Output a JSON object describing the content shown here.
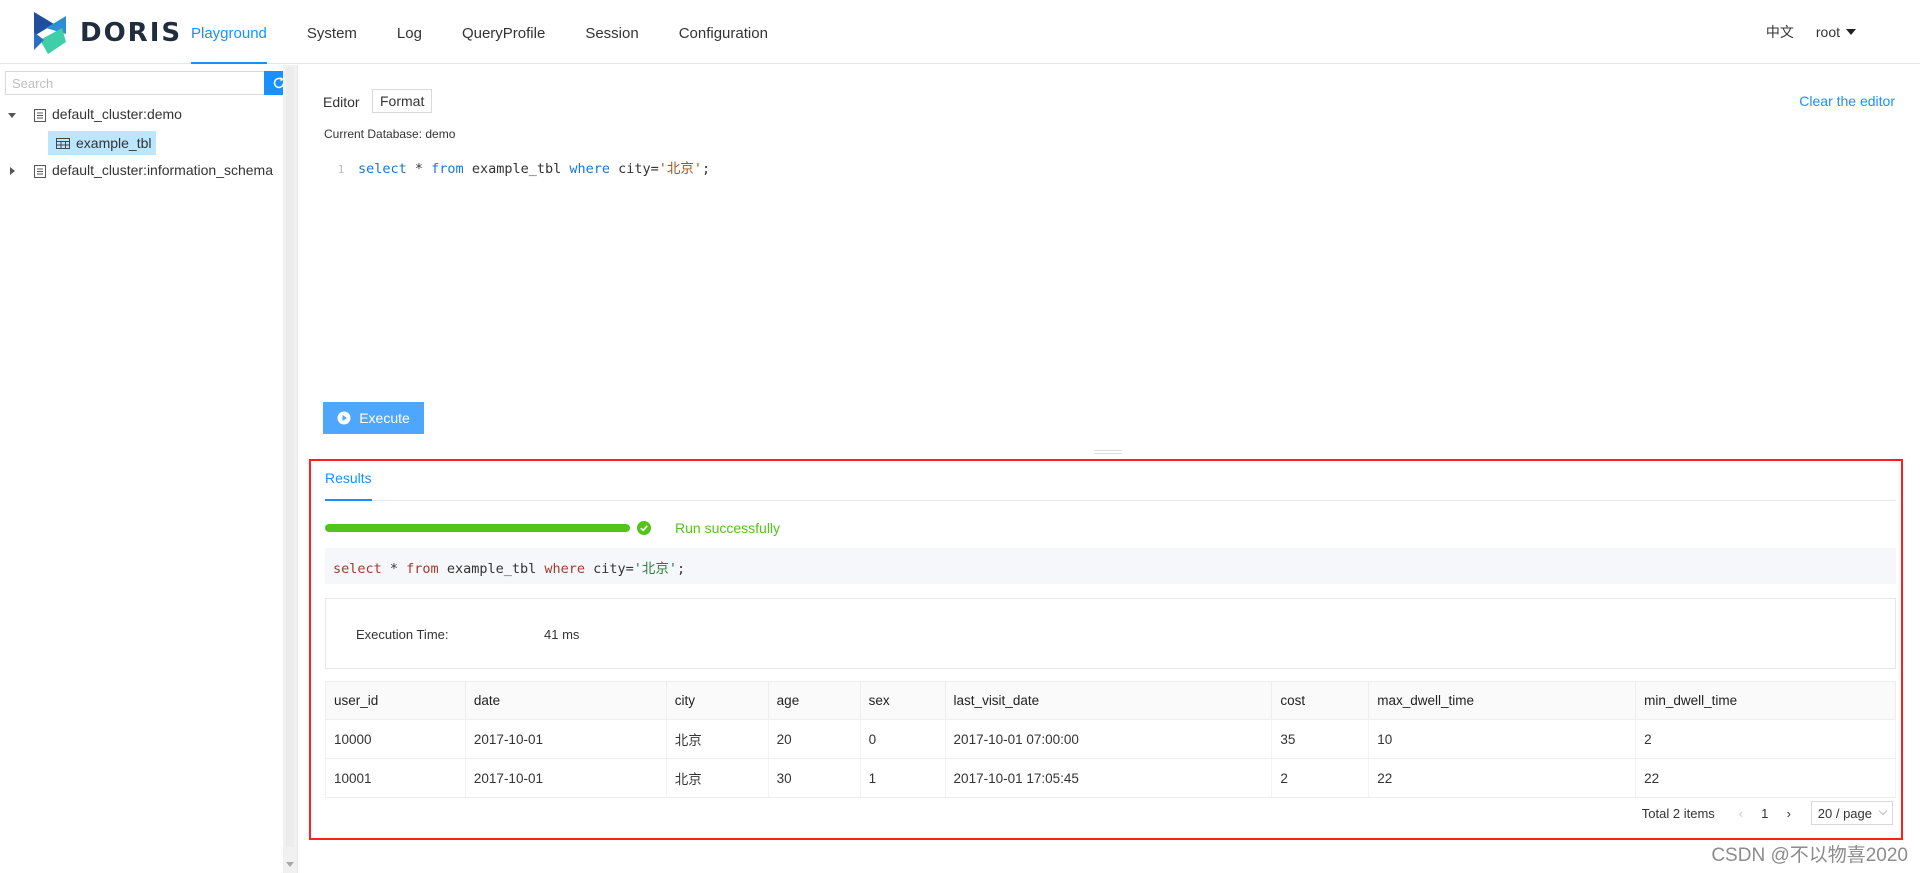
{
  "app": {
    "brand": "DORIS"
  },
  "nav": {
    "items": [
      {
        "label": "Playground",
        "active": true
      },
      {
        "label": "System",
        "active": false
      },
      {
        "label": "Log",
        "active": false
      },
      {
        "label": "QueryProfile",
        "active": false
      },
      {
        "label": "Session",
        "active": false
      },
      {
        "label": "Configuration",
        "active": false
      }
    ],
    "language": "中文",
    "user": "root"
  },
  "sidebar": {
    "search_placeholder": "Search",
    "tree": [
      {
        "label": "default_cluster:demo",
        "expanded": true,
        "children": [
          {
            "label": "example_tbl",
            "selected": true
          }
        ]
      },
      {
        "label": "default_cluster:information_schema",
        "expanded": false
      }
    ]
  },
  "editor": {
    "label": "Editor",
    "format_label": "Format",
    "clear_label": "Clear the editor",
    "current_database": "Current Database: demo",
    "line_number": "1",
    "code": {
      "kw_select": "select",
      "star": " * ",
      "kw_from": "from",
      "table": " example_tbl ",
      "kw_where": "where",
      "cond": " city=",
      "literal": "'北京'",
      "end": ";"
    },
    "execute_label": "Execute"
  },
  "results": {
    "tab_label": "Results",
    "progress": 1.0,
    "status": "Run successfully",
    "execution_time_label": "Execution Time:",
    "execution_time_value": "41 ms",
    "columns": [
      "user_id",
      "date",
      "city",
      "age",
      "sex",
      "last_visit_date",
      "cost",
      "max_dwell_time",
      "min_dwell_time"
    ],
    "rows": [
      [
        "10000",
        "2017-10-01",
        "北京",
        "20",
        "0",
        "2017-10-01 07:00:00",
        "35",
        "10",
        "2"
      ],
      [
        "10001",
        "2017-10-01",
        "北京",
        "30",
        "1",
        "2017-10-01 17:05:45",
        "2",
        "22",
        "22"
      ]
    ],
    "pagination": {
      "total": "Total 2 items",
      "current_page": "1",
      "page_size": "20 / page"
    }
  },
  "watermark": "CSDN @不以物喜2020",
  "colors": {
    "primary": "#1890ff",
    "success": "#52c41a",
    "highlight_border": "#ff1f1f"
  }
}
